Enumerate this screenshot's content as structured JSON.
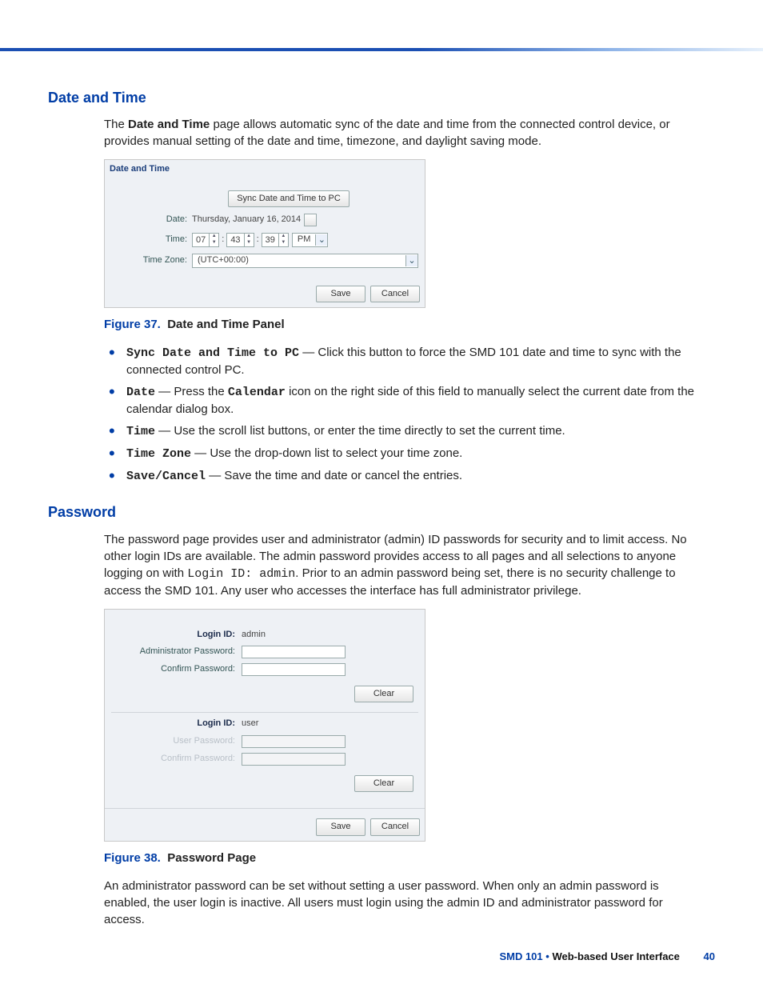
{
  "sections": {
    "datetime": {
      "heading": "Date and Time",
      "intro": "The ",
      "intro_bold": "Date and Time",
      "intro_tail": " page allows automatic sync of the date and time from the connected control device, or provides manual setting of the date and time, timezone, and daylight saving mode.",
      "panel": {
        "legend": "Date and Time",
        "sync_button": "Sync Date and Time to PC",
        "date_label": "Date:",
        "date_value": "Thursday, January 16, 2014",
        "time_label": "Time:",
        "hh": "07",
        "mm": "43",
        "ss": "39",
        "ampm": "PM",
        "tz_label": "Time Zone:",
        "tz_value": "(UTC+00:00)",
        "save": "Save",
        "cancel": "Cancel"
      },
      "figure": {
        "label": "Figure 37.",
        "title": "Date and Time Panel"
      },
      "bullets": [
        {
          "term": "Sync Date and Time to PC",
          "text": " — Click this button to force the SMD 101 date and time to sync with the connected control PC."
        },
        {
          "term": "Date",
          "text_pre": " — Press the ",
          "term2": "Calendar",
          "text_post": " icon on the right side of this field to manually select the current date from the calendar dialog box."
        },
        {
          "term": "Time",
          "text": " — Use the scroll list buttons, or enter the time directly to set the current time."
        },
        {
          "term": "Time Zone",
          "text": " — Use the drop-down list to select your time zone."
        },
        {
          "term": "Save/Cancel",
          "text": " — Save the time and date or cancel the entries."
        }
      ]
    },
    "password": {
      "heading": "Password",
      "intro_pre": "The password page provides user and administrator (admin) ID passwords for security and to limit access. No other login IDs are available. The admin password provides access to all pages and all selections to anyone logging on with ",
      "intro_mono": "Login ID: admin",
      "intro_post": ". Prior to an admin password being set, there is no security challenge to access the SMD 101. Any user who accesses the interface has full administrator privilege.",
      "panel": {
        "login_id_label": "Login ID:",
        "admin_id": "admin",
        "admin_pw_label": "Administrator Password:",
        "confirm_label": "Confirm Password:",
        "clear": "Clear",
        "user_id": "user",
        "user_pw_label": "User Password:",
        "save": "Save",
        "cancel": "Cancel"
      },
      "figure": {
        "label": "Figure 38.",
        "title": "Password Page"
      },
      "after": "An administrator password can be set without setting a user password. When only an admin password is enabled, the user login is inactive. All users must login using the admin ID and administrator password for access."
    }
  },
  "footer": {
    "product": "SMD 101",
    "bullet": "•",
    "chapter": "Web-based User Interface",
    "page": "40"
  }
}
